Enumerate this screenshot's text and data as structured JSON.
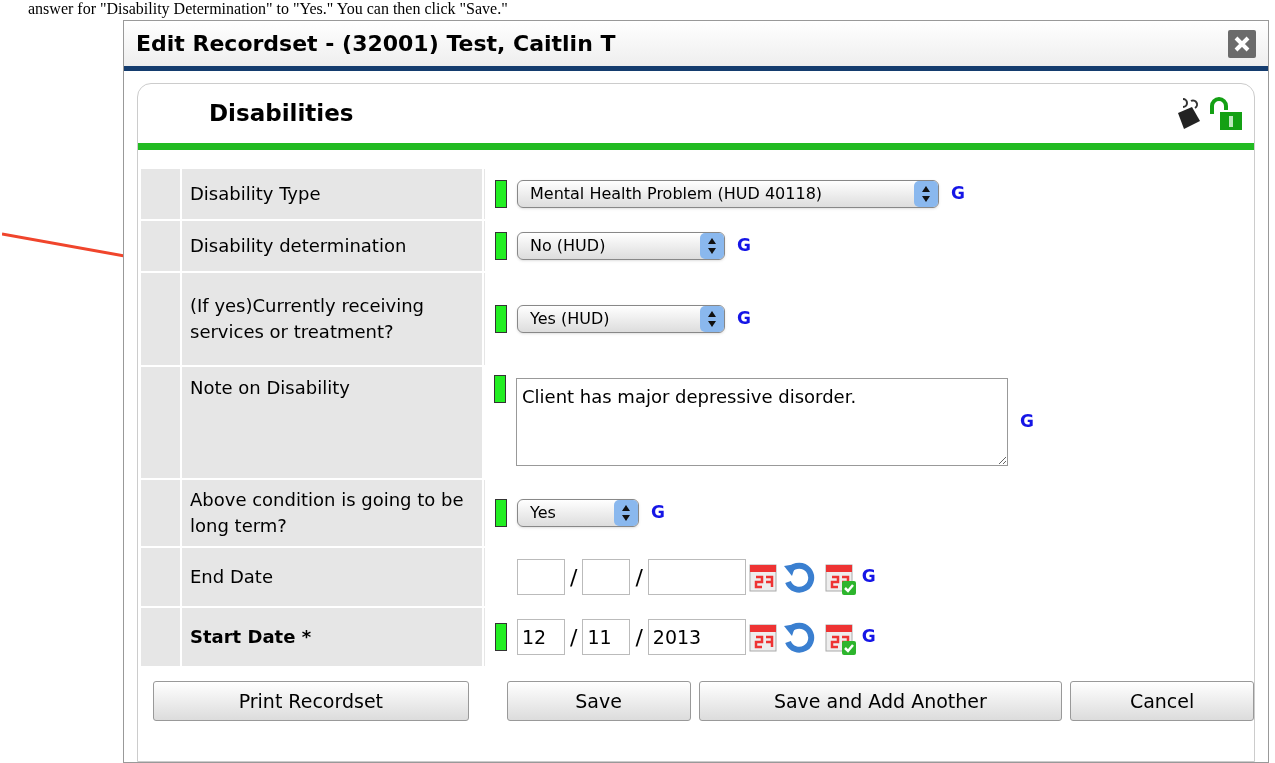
{
  "document_text": "answer for \"Disability Determination\" to \"Yes.\" You can then click \"Save.\"",
  "dialog": {
    "title": "Edit Recordset - (32001) Test, Caitlin T"
  },
  "section": {
    "title": "Disabilities"
  },
  "rows": [
    {
      "kind": "select",
      "label": "Disability Type",
      "bold": false,
      "indicator": true,
      "value": "Mental Health Problem (HUD 40118)",
      "link": "G"
    },
    {
      "kind": "select",
      "label": "Disability determination",
      "bold": false,
      "indicator": true,
      "value": "No (HUD)",
      "link": "G"
    },
    {
      "kind": "select",
      "label": "(If yes)Currently receiving services or treatment?",
      "bold": false,
      "indicator": true,
      "value": "Yes (HUD)",
      "link": "G"
    },
    {
      "kind": "textarea",
      "label": "Note on Disability",
      "bold": false,
      "indicator": true,
      "value": "Client has major depressive disorder.",
      "link": "G"
    },
    {
      "kind": "select",
      "label": "Above condition is going to be long term?",
      "bold": false,
      "indicator": true,
      "value": "Yes",
      "link": "G"
    },
    {
      "kind": "date",
      "label": "End Date",
      "bold": false,
      "indicator": false,
      "month": "",
      "day": "",
      "year": "",
      "separator": "/",
      "link": "G"
    },
    {
      "kind": "date",
      "label": "Start Date *",
      "bold": true,
      "indicator": true,
      "month": "12",
      "day": "11",
      "year": "2013",
      "separator": "/",
      "link": "G"
    }
  ],
  "buttons": [
    {
      "label": "Print Recordset"
    },
    {
      "label": "Save"
    },
    {
      "label": "Save and Add Another"
    },
    {
      "label": "Cancel"
    }
  ]
}
